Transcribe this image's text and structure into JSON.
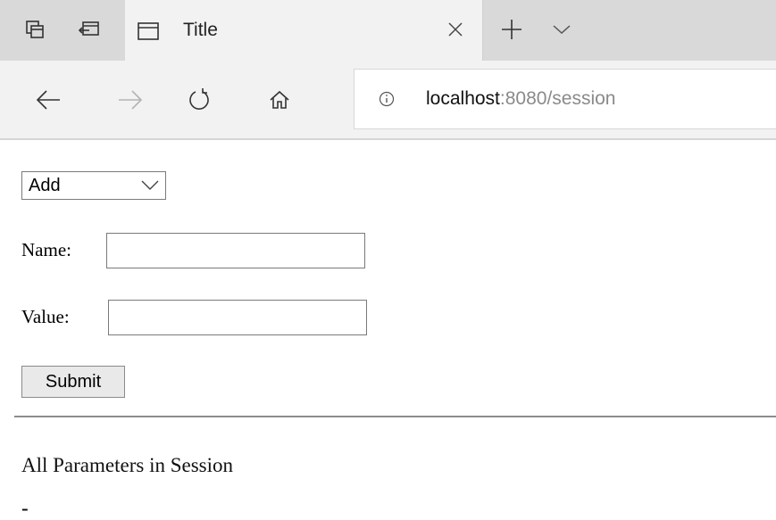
{
  "browser": {
    "tab": {
      "title": "Title"
    },
    "address_bar": {
      "host": "localhost",
      "rest": ":8080/session"
    },
    "icons": {
      "tab_previews": "tab-previews-icon",
      "set_aside": "set-aside-tabs-icon",
      "tab_page": "page-icon",
      "close": "close-icon",
      "new_tab": "plus-icon",
      "tab_list": "chevron-down-icon",
      "back": "back-arrow-icon",
      "forward": "forward-arrow-icon",
      "refresh": "refresh-icon",
      "home": "home-icon",
      "site_info": "info-icon"
    }
  },
  "page": {
    "action_select": {
      "selected": "Add"
    },
    "name_field": {
      "label": "Name:",
      "value": ""
    },
    "value_field": {
      "label": "Value:",
      "value": ""
    },
    "submit_label": "Submit",
    "section_heading": "All Parameters in Session",
    "list_marker": "-"
  }
}
